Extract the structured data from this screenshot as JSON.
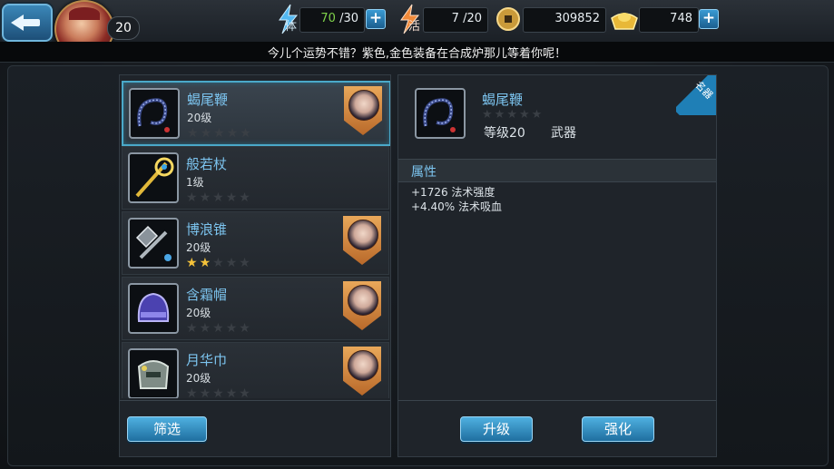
{
  "header": {
    "player_level": "20",
    "stamina": {
      "label": "体",
      "current": "70",
      "max": "/30"
    },
    "vigor": {
      "label": "活",
      "current": "7",
      "max": "/20"
    },
    "coins": "309852",
    "gold": "748"
  },
  "notice": "今儿个运势不错？紫色,金色装备在合成炉那儿等着你呢！",
  "equipment_list": [
    {
      "name": "蝎尾鞭",
      "level": "20级",
      "stars": 0,
      "has_owner": true
    },
    {
      "name": "般若杖",
      "level": "1级",
      "stars": 0,
      "has_owner": false
    },
    {
      "name": "博浪锥",
      "level": "20级",
      "stars": 2,
      "has_owner": true
    },
    {
      "name": "含霜帽",
      "level": "20级",
      "stars": 0,
      "has_owner": true
    },
    {
      "name": "月华巾",
      "level": "20级",
      "stars": 0,
      "has_owner": true
    }
  ],
  "filter_button": "筛选",
  "detail": {
    "name": "蝎尾鞭",
    "level": "等级20",
    "type": "武器",
    "rarity": "名器",
    "attributes_title": "属性",
    "attributes": [
      "+1726 法术强度",
      "+4.40% 法术吸血"
    ]
  },
  "buttons": {
    "upgrade": "升级",
    "enhance": "强化"
  },
  "colors": {
    "accent": "#7cc4ef",
    "button": "#2f8ac0",
    "star_on": "#f4c23a"
  }
}
